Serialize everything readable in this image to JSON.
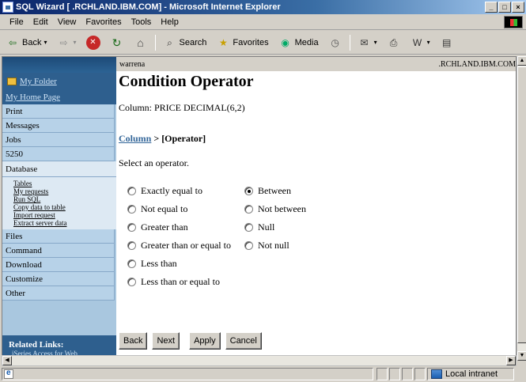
{
  "window": {
    "title": "SQL Wizard [        .RCHLAND.IBM.COM] - Microsoft Internet Explorer",
    "min": "_",
    "max": "□",
    "close": "×"
  },
  "menu": [
    "File",
    "Edit",
    "View",
    "Favorites",
    "Tools",
    "Help"
  ],
  "toolbar": {
    "back": "Back",
    "search": "Search",
    "favorites": "Favorites",
    "media": "Media"
  },
  "nav": {
    "folder": "My Folder",
    "home": "My Home Page",
    "items_top": [
      "Print",
      "Messages",
      "Jobs",
      "5250"
    ],
    "active": "Database",
    "subitems": [
      "Tables",
      "My requests",
      "Run SQL",
      "Copy data to table",
      "Import request",
      "Extract server data"
    ],
    "items_bottom": [
      "Files",
      "Command",
      "Download",
      "Customize",
      "Other"
    ],
    "related_title": "Related Links:",
    "related_link": "iSeries Access for Web"
  },
  "header": {
    "user": "warrena",
    "system": ".RCHLAND.IBM.COM"
  },
  "page": {
    "title": "Condition Operator",
    "column": "Column: PRICE  DECIMAL(6,2)",
    "crumb_link": "Column",
    "crumb_sep": " > ",
    "crumb_current": "[Operator]",
    "instruction": "Select an operator."
  },
  "operators": {
    "left": [
      "Exactly equal to",
      "Not equal to",
      "Greater than",
      "Greater than or equal to",
      "Less than",
      "Less than or equal to"
    ],
    "right": [
      "Between",
      "Not between",
      "Null",
      "Not null"
    ],
    "selected": "Between"
  },
  "buttons": {
    "back": "Back",
    "next": "Next",
    "apply": "Apply",
    "cancel": "Cancel"
  },
  "status": {
    "zone": "Local intranet"
  }
}
